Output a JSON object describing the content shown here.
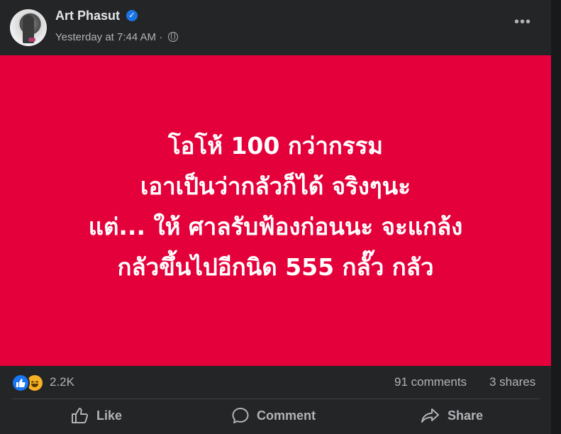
{
  "post": {
    "author": "Art Phasut",
    "timestamp": "Yesterday at 7:44 AM",
    "separator": "·",
    "more_label": "•••",
    "lines": [
      "โอโห้ 100 กว่ากรรม",
      "เอาเป็นว่ากลัวก็ได้ จริงๆนะ",
      "แต่... ให้ ศาลรับฟ้องก่อนนะ จะแกล้ง",
      "กลัวขึ้นไปอีกนิด 555 กลั๊ว กลัว"
    ],
    "background_color": "#e4003a"
  },
  "stats": {
    "reaction_count": "2.2K",
    "comments": "91 comments",
    "shares": "3 shares"
  },
  "actions": {
    "like": "Like",
    "comment": "Comment",
    "share": "Share"
  }
}
